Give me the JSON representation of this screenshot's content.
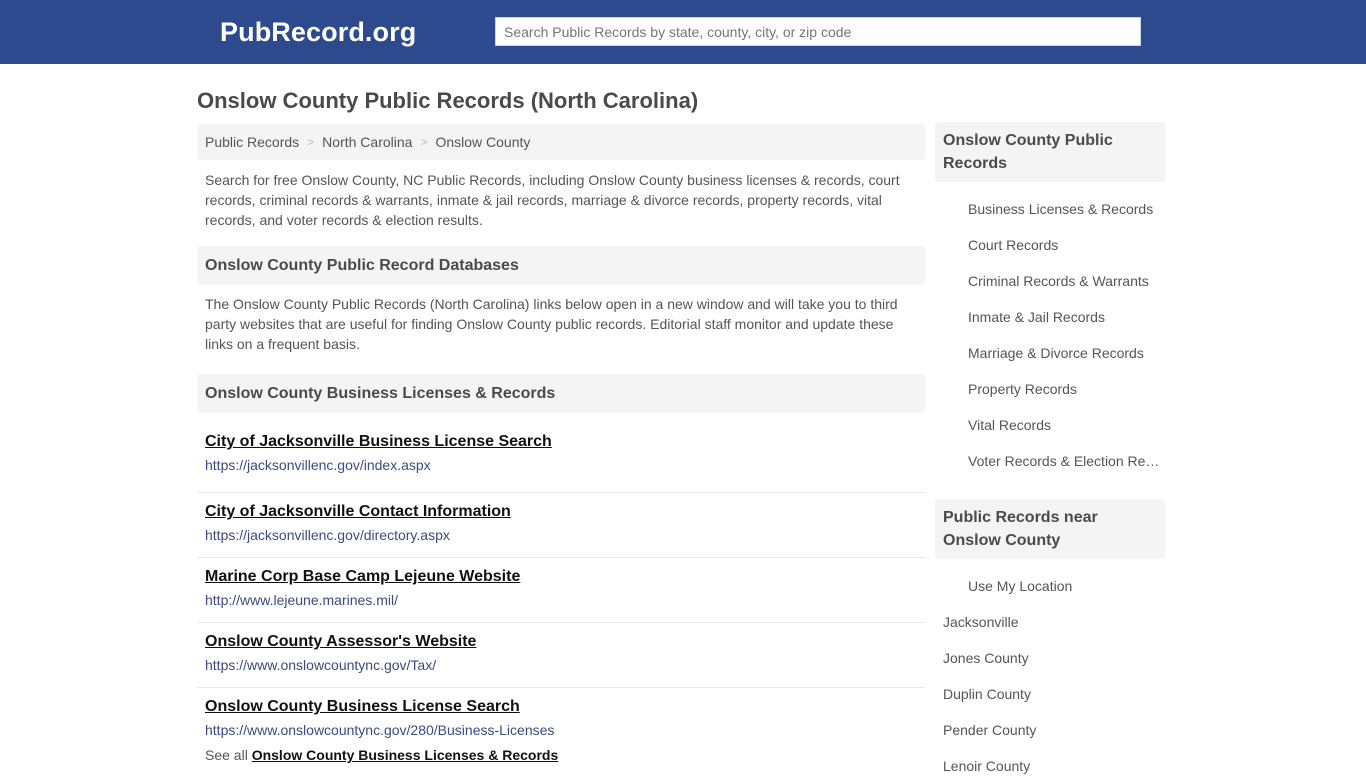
{
  "header": {
    "logo": "PubRecord.org",
    "search_placeholder": "Search Public Records by state, county, city, or zip code",
    "search_value": "",
    "brand_color": "#2e4a8f"
  },
  "page": {
    "title": "Onslow County Public Records (North Carolina)"
  },
  "breadcrumb": [
    {
      "label": "Public Records"
    },
    {
      "label": "North Carolina"
    },
    {
      "label": "Onslow County"
    }
  ],
  "breadcrumb_separator": ">",
  "intro": "Search for free Onslow County, NC Public Records, including Onslow County business licenses & records, court records, criminal records & warrants, inmate & jail records, marriage & divorce records, property records, vital records, and voter records & election results.",
  "databases": {
    "heading": "Onslow County Public Record Databases",
    "description": "The Onslow County Public Records (North Carolina) links below open in a new window and will take you to third party websites that are useful for finding Onslow County public records. Editorial staff monitor and update these links on a frequent basis."
  },
  "business": {
    "heading": "Onslow County Business Licenses & Records",
    "links": [
      {
        "title": "City of Jacksonville Business License Search",
        "url": "https://jacksonvillenc.gov/index.aspx"
      },
      {
        "title": "City of Jacksonville Contact Information",
        "url": "https://jacksonvillenc.gov/directory.aspx"
      },
      {
        "title": "Marine Corp Base Camp Lejeune Website",
        "url": "http://www.lejeune.marines.mil/"
      },
      {
        "title": "Onslow County Assessor's Website",
        "url": "https://www.onslowcountync.gov/Tax/"
      },
      {
        "title": "Onslow County Business License Search",
        "url": "https://www.onslowcountync.gov/280/Business-Licenses"
      }
    ],
    "see_all_prefix": "See all",
    "see_all_link": "Onslow County Business Licenses & Records"
  },
  "sidebar": {
    "records_heading": "Onslow County Public Records",
    "records_items": [
      "Business Licenses & Records",
      "Court Records",
      "Criminal Records & Warrants",
      "Inmate & Jail Records",
      "Marriage & Divorce Records",
      "Property Records",
      "Vital Records",
      "Voter Records & Election Results"
    ],
    "near_heading": "Public Records near Onslow County",
    "use_location": "Use My Location",
    "near_items": [
      "Jacksonville",
      "Jones County",
      "Duplin County",
      "Pender County",
      "Lenoir County"
    ]
  }
}
